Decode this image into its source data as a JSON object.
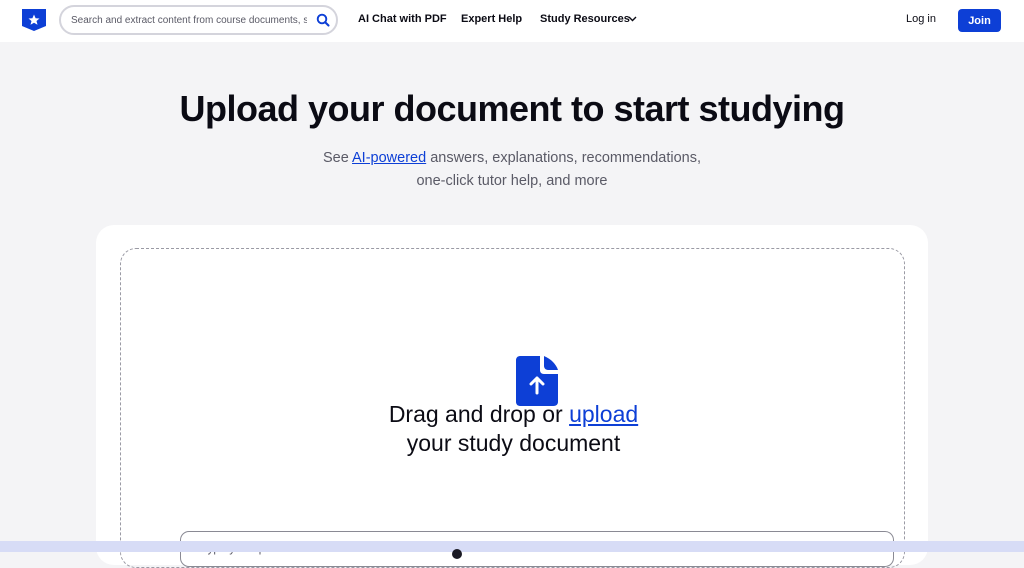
{
  "header": {
    "logo_icon": "shield-star-logo",
    "search_placeholder": "Search and extract content from course documents, study guides, and more",
    "search_icon": "search-icon",
    "nav_items": [
      {
        "label": "AI Chat with PDF"
      },
      {
        "label": "Expert Help"
      },
      {
        "label": "Study Resources",
        "has_dropdown": true
      }
    ],
    "login_label": "Log in",
    "join_label": "Join"
  },
  "hero": {
    "title": "Upload your document to start studying",
    "subtitle_prefix": "See ",
    "subtitle_link": "AI-powered",
    "subtitle_rest": " answers, explanations, recommendations,",
    "subtitle_line2": "one-click tutor help, and more"
  },
  "upload": {
    "icon": "file-upload-icon",
    "drag_text": "Drag and drop or ",
    "upload_link": "upload",
    "drag_text_line2": "your study document",
    "question_placeholder": "or type your question here"
  },
  "colors": {
    "accent": "#0d3fd6",
    "background": "#f4f4f6",
    "text": "#0b0b14"
  }
}
